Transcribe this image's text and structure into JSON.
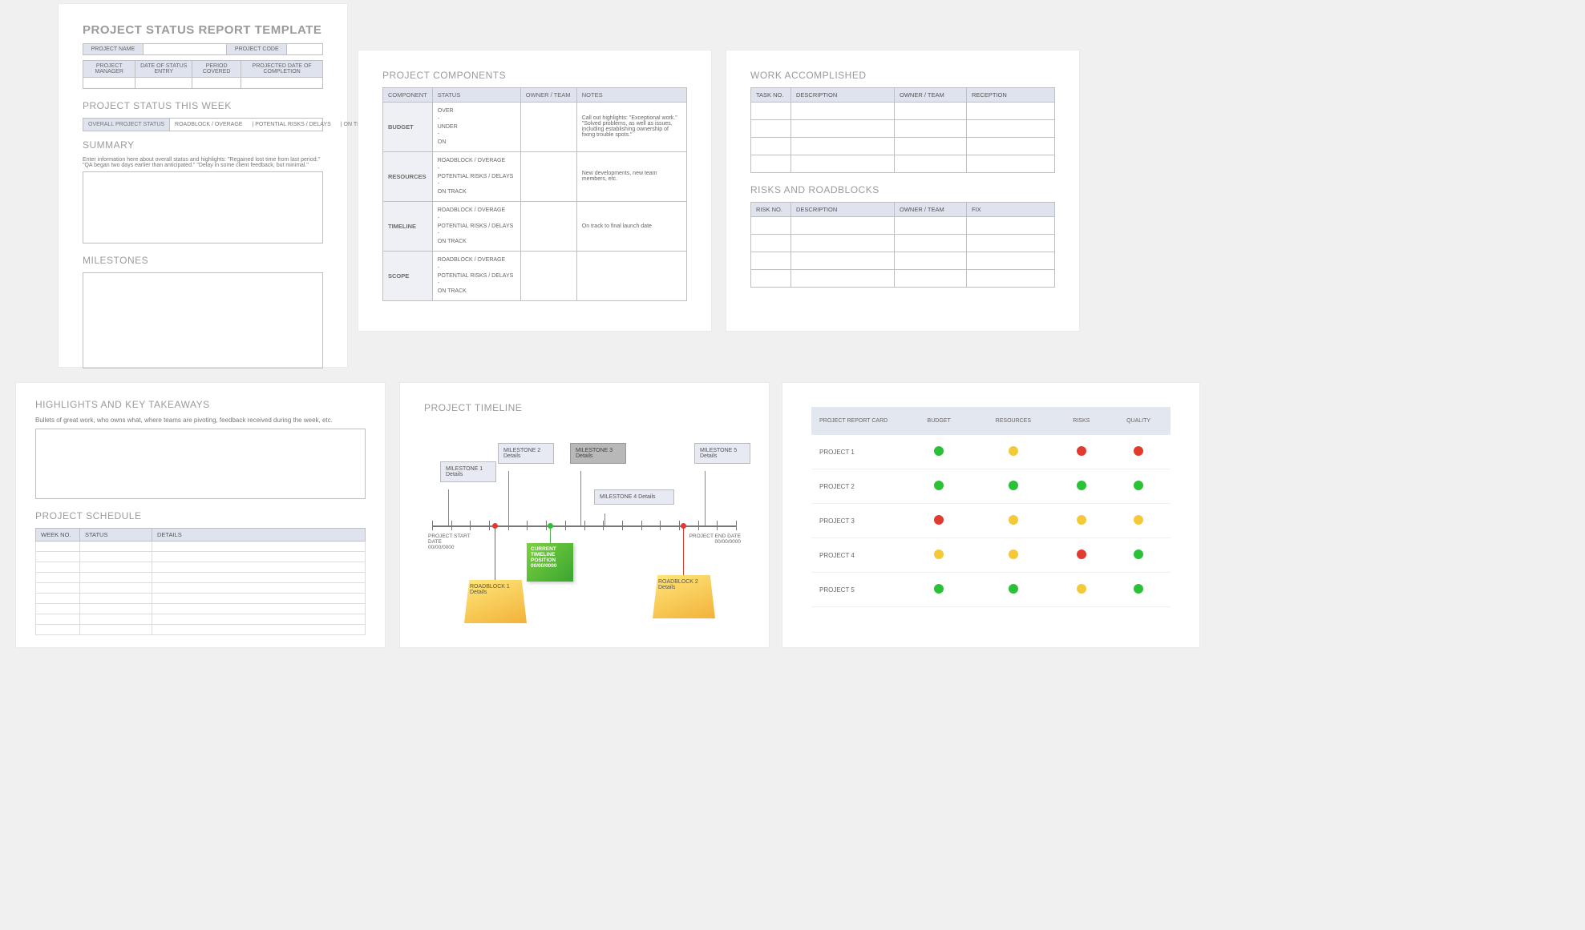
{
  "page1": {
    "title": "PROJECT STATUS REPORT TEMPLATE",
    "row1": {
      "name_label": "PROJECT NAME",
      "code_label": "PROJECT CODE"
    },
    "row2": {
      "pm": "PROJECT MANAGER",
      "entry": "DATE OF STATUS ENTRY",
      "period": "PERIOD COVERED",
      "pdc": "PROJECTED DATE OF COMPLETION"
    },
    "status_heading": "PROJECT STATUS THIS WEEK",
    "statusbar": {
      "label": "OVERALL PROJECT STATUS",
      "a": "ROADBLOCK / OVERAGE",
      "b": "POTENTIAL RISKS / DELAYS",
      "c": "ON TRACK"
    },
    "summary_label": "SUMMARY",
    "summary_help": "Enter information here about overall status and highlights: \"Regained lost time from last period.\" \"QA began two days earlier than anticipated.\" \"Delay in some client feedback, but minimal.\"",
    "milestones_label": "MILESTONES"
  },
  "page2": {
    "heading": "PROJECT COMPONENTS",
    "cols": {
      "c1": "COMPONENT",
      "c2": "STATUS",
      "c3": "OWNER / TEAM",
      "c4": "NOTES"
    },
    "rows": [
      {
        "name": "BUDGET",
        "status": "OVER\n-\nUNDER\n-\nON",
        "notes": "Call out highlights: \"Exceptional work.\" \"Solved problems, as well as issues, including establishing ownership of fixing trouble spots.\""
      },
      {
        "name": "RESOURCES",
        "status": "ROADBLOCK / OVERAGE\n-\nPOTENTIAL RISKS / DELAYS\n-\nON TRACK",
        "notes": "New developments, new team members, etc."
      },
      {
        "name": "TIMELINE",
        "status": "ROADBLOCK / OVERAGE\n-\nPOTENTIAL RISKS / DELAYS\n-\nON TRACK",
        "notes": "On track to final launch date"
      },
      {
        "name": "SCOPE",
        "status": "ROADBLOCK / OVERAGE\n-\nPOTENTIAL RISKS / DELAYS\n-\nON TRACK",
        "notes": ""
      }
    ]
  },
  "page3": {
    "work_heading": "WORK ACCOMPLISHED",
    "work_cols": {
      "c1": "TASK NO.",
      "c2": "DESCRIPTION",
      "c3": "OWNER / TEAM",
      "c4": "RECEPTION"
    },
    "risk_heading": "RISKS AND ROADBLOCKS",
    "risk_cols": {
      "c1": "RISK NO.",
      "c2": "DESCRIPTION",
      "c3": "OWNER / TEAM",
      "c4": "FIX"
    }
  },
  "page4": {
    "heading": "HIGHLIGHTS AND KEY TAKEAWAYS",
    "help": "Bullets of great work, who owns what, where teams are pivoting, feedback received during the week, etc.",
    "sched_heading": "PROJECT SCHEDULE",
    "sched_cols": {
      "c1": "WEEK NO.",
      "c2": "STATUS",
      "c3": "DETAILS"
    }
  },
  "page5": {
    "heading": "PROJECT TIMELINE",
    "start_label": "PROJECT START DATE",
    "start_date": "00/00/0000",
    "end_label": "PROJECT END DATE",
    "end_date": "00/00/0000",
    "m1": "MILESTONE 1\nDetails",
    "m2": "MILESTONE 2\nDetails",
    "m3": "MILESTONE 3\nDetails",
    "m4": "MILESTONE 4\nDetails",
    "m5": "MILESTONE 5\nDetails",
    "current": "CURRENT TIMELINE POSITION 00/00/0000",
    "rb1": "ROADBLOCK 1\nDetails",
    "rb2": "ROADBLOCK 2\nDetails"
  },
  "page6": {
    "cols": {
      "c0": "PROJECT REPORT CARD",
      "c1": "BUDGET",
      "c2": "RESOURCES",
      "c3": "RISKS",
      "c4": "QUALITY"
    },
    "rows": [
      {
        "name": "PROJECT 1",
        "lights": [
          "g",
          "y",
          "r",
          "r"
        ]
      },
      {
        "name": "PROJECT 2",
        "lights": [
          "g",
          "g",
          "g",
          "g"
        ]
      },
      {
        "name": "PROJECT 3",
        "lights": [
          "r",
          "y",
          "y",
          "y"
        ]
      },
      {
        "name": "PROJECT 4",
        "lights": [
          "y",
          "y",
          "r",
          "g"
        ]
      },
      {
        "name": "PROJECT 5",
        "lights": [
          "g",
          "g",
          "y",
          "g"
        ]
      }
    ]
  }
}
